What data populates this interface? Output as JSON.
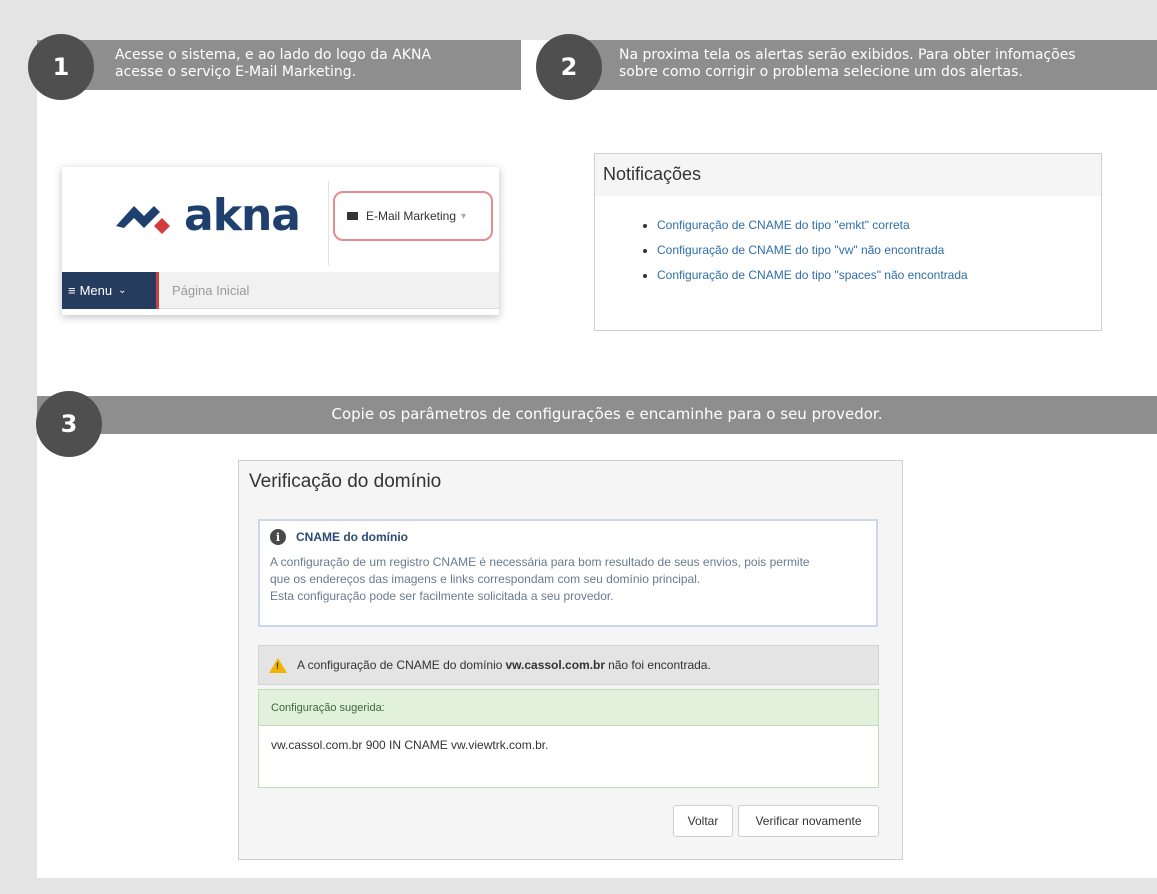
{
  "steps": [
    {
      "number": "1",
      "text_line1": "Acesse o sistema, e ao lado do logo da AKNA",
      "text_line2": "acesse o serviço E-Mail Marketing."
    },
    {
      "number": "2",
      "text_line1": "Na proxima tela os alertas serão exibidos. Para obter infomações",
      "text_line2": "sobre como corrigir o problema selecione um dos alertas."
    },
    {
      "number": "3",
      "text": "Copie os parâmetros de configurações e encaminhe para o seu provedor."
    }
  ],
  "akna": {
    "logo_word": "akna",
    "service_button": "E-Mail Marketing",
    "menu_label": "Menu",
    "breadcrumb": "Página Inicial"
  },
  "notifications": {
    "title": "Notificações",
    "items": [
      "Configuração de CNAME do tipo \"emkt\" correta",
      "Configuração de CNAME do tipo \"vw\" não encontrada",
      "Configuração de CNAME do tipo \"spaces\" não encontrada"
    ]
  },
  "verification": {
    "title": "Verificação do domínio",
    "cname_title": "CNAME do domínio",
    "cname_line1": "A configuração de um registro CNAME é necessária para bom resultado de seus envios, pois permite",
    "cname_line2": "que os endereços das imagens e links correspondam com seu domínio principal.",
    "cname_line3": "Esta configuração pode ser facilmente solicitada a seu provedor.",
    "warning_prefix": "A configuração de CNAME do domínio",
    "warning_domain": "vw.cassol.com.br",
    "warning_suffix": "não foi encontrada.",
    "suggested_label": "Configuração sugerida:",
    "suggested_record": "vw.cassol.com.br 900 IN CNAME vw.viewtrk.com.br.",
    "back_button": "Voltar",
    "verify_button": "Verificar novamente"
  }
}
